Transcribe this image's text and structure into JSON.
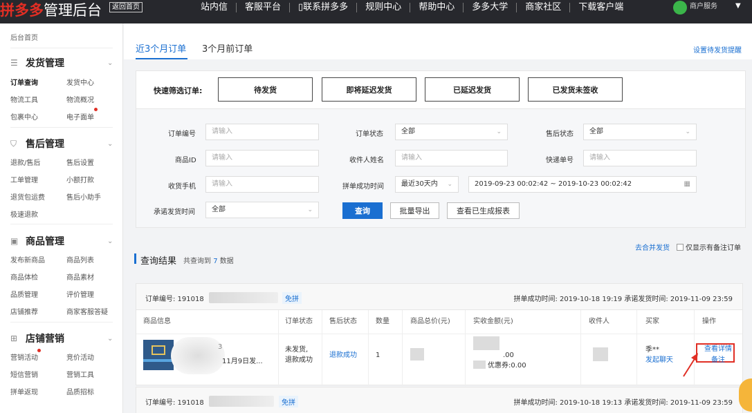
{
  "topbar": {
    "logo_red": "拼多多",
    "logo_rest": "管理后台",
    "back_home": "返回首页",
    "nav": [
      "站内信",
      "客服平台",
      "▯联系拼多多",
      "规则中心",
      "帮助中心",
      "多多大学",
      "商家社区",
      "下载客户端"
    ],
    "user_name": "商户服务"
  },
  "sidebar": {
    "home": "后台首页",
    "groups": [
      {
        "title": "发货管理",
        "links": [
          "订单查询",
          "发货中心",
          "物流工具",
          "物流概况",
          "包裹中心",
          "电子面单"
        ]
      },
      {
        "title": "售后管理",
        "links": [
          "退款/售后",
          "售后设置",
          "工单管理",
          "小额打款",
          "退货包运费",
          "售后小助手",
          "极速退款"
        ]
      },
      {
        "title": "商品管理",
        "links": [
          "发布新商品",
          "商品列表",
          "商品体检",
          "商品素材",
          "品质管理",
          "评价管理",
          "店铺推荐",
          "商家客服答疑"
        ]
      },
      {
        "title": "店铺营销",
        "links": [
          "营销活动",
          "竞价活动",
          "短信营销",
          "营销工具",
          "拼单返现",
          "品质招标"
        ]
      }
    ]
  },
  "tabs": {
    "recent": "近3个月订单",
    "older": "3个月前订单",
    "settings_link": "设置待发货提醒"
  },
  "quick_filter": {
    "label": "快速筛选订单:",
    "buttons": [
      "待发货",
      "即将延迟发货",
      "已延迟发货",
      "已发货未签收"
    ]
  },
  "filters": {
    "order_no_label": "订单编号",
    "order_status_label": "订单状态",
    "after_sale_label": "售后状态",
    "product_id_label": "商品ID",
    "receiver_label": "收件人姓名",
    "express_label": "快递单号",
    "phone_label": "收货手机",
    "success_time_label": "拼单成功时间",
    "ship_time_label": "承诺发货时间",
    "placeholder": "请输入",
    "all": "全部",
    "recent30": "最近30天内",
    "date_range": "2019-09-23 00:02:42 ~ 2019-10-23 00:02:42",
    "query_btn": "查询",
    "export_btn": "批量导出",
    "report_btn": "查看已生成报表"
  },
  "results": {
    "merge_link": "去合并发货",
    "only_remark": "仅显示有备注订单",
    "title": "查询结果",
    "count_prefix": "共查询到",
    "count": "7",
    "count_suffix": "数据"
  },
  "columns": [
    "商品信息",
    "订单状态",
    "售后状态",
    "数量",
    "商品总价(元)",
    "实收金额(元)",
    "收件人",
    "买家",
    "操作"
  ],
  "orders": [
    {
      "order_label": "订单编号: 191018",
      "tag": "免拼",
      "time": "拼单成功时间: 2019-10-18 19:19  承诺发货时间: 2019-11-09 23:59",
      "product_frag1": "3",
      "product_frag2": "11月9日发...",
      "status": "未发货,\n退款成功",
      "after_sale": "退款成功",
      "qty": "1",
      "amount": ".00",
      "coupon": "优惠券:0.00",
      "buyer": "季**",
      "chat": "发起聊天",
      "detail": "查看详情",
      "remark": "备注"
    },
    {
      "order_label": "订单编号: 191018",
      "tag": "免拼",
      "time": "拼单成功时间: 2019-10-18 19:13  承诺发货时间: 2019-11-09 23:59"
    }
  ]
}
